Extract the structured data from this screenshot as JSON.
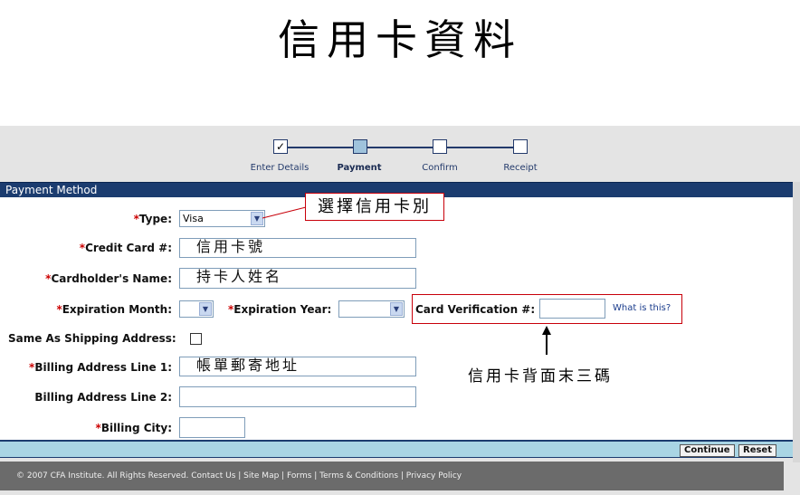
{
  "annotation_title": "信用卡資料",
  "steps": [
    {
      "label": "Enter Details",
      "state": "done",
      "mark": "✓"
    },
    {
      "label": "Payment",
      "state": "current",
      "mark": ""
    },
    {
      "label": "Confirm",
      "state": "todo",
      "mark": ""
    },
    {
      "label": "Receipt",
      "state": "todo",
      "mark": ""
    }
  ],
  "panel": {
    "title": "Payment Method"
  },
  "form": {
    "type": {
      "label": "Type:",
      "value": "Visa"
    },
    "credit_card": {
      "label": "Credit Card #:",
      "value": "信用卡號"
    },
    "cardholder": {
      "label": "Cardholder's Name:",
      "value": "持卡人姓名"
    },
    "exp_month": {
      "label": "Expiration Month:",
      "value": ""
    },
    "exp_year": {
      "label": "Expiration Year:",
      "value": ""
    },
    "cvv": {
      "label": "Card Verification #:",
      "value": "",
      "help_link": "What is this?"
    },
    "same_as_shipping": {
      "label": "Same As Shipping Address:",
      "checked": false
    },
    "billing1": {
      "label": "Billing Address Line 1:",
      "value": "帳單郵寄地址"
    },
    "billing2": {
      "label": "Billing Address Line 2:",
      "value": ""
    },
    "billing_city": {
      "label": "Billing City:",
      "value": ""
    },
    "required_mark": "*"
  },
  "annotations": {
    "card_type_callout": "選擇信用卡別",
    "cvv_note": "信用卡背面末三碼"
  },
  "buttons": {
    "continue": "Continue",
    "reset": "Reset"
  },
  "footer": {
    "text": "© 2007 CFA Institute. All Rights Reserved. Contact Us | Site Map | Forms | Terms & Conditions | Privacy Policy"
  },
  "colors": {
    "header_bg": "#1b3c6f",
    "required": "#cc0000",
    "callout_border": "#c8000a",
    "footer_bg": "#6b6b6b",
    "bottom_bar": "#a9d5e4"
  }
}
